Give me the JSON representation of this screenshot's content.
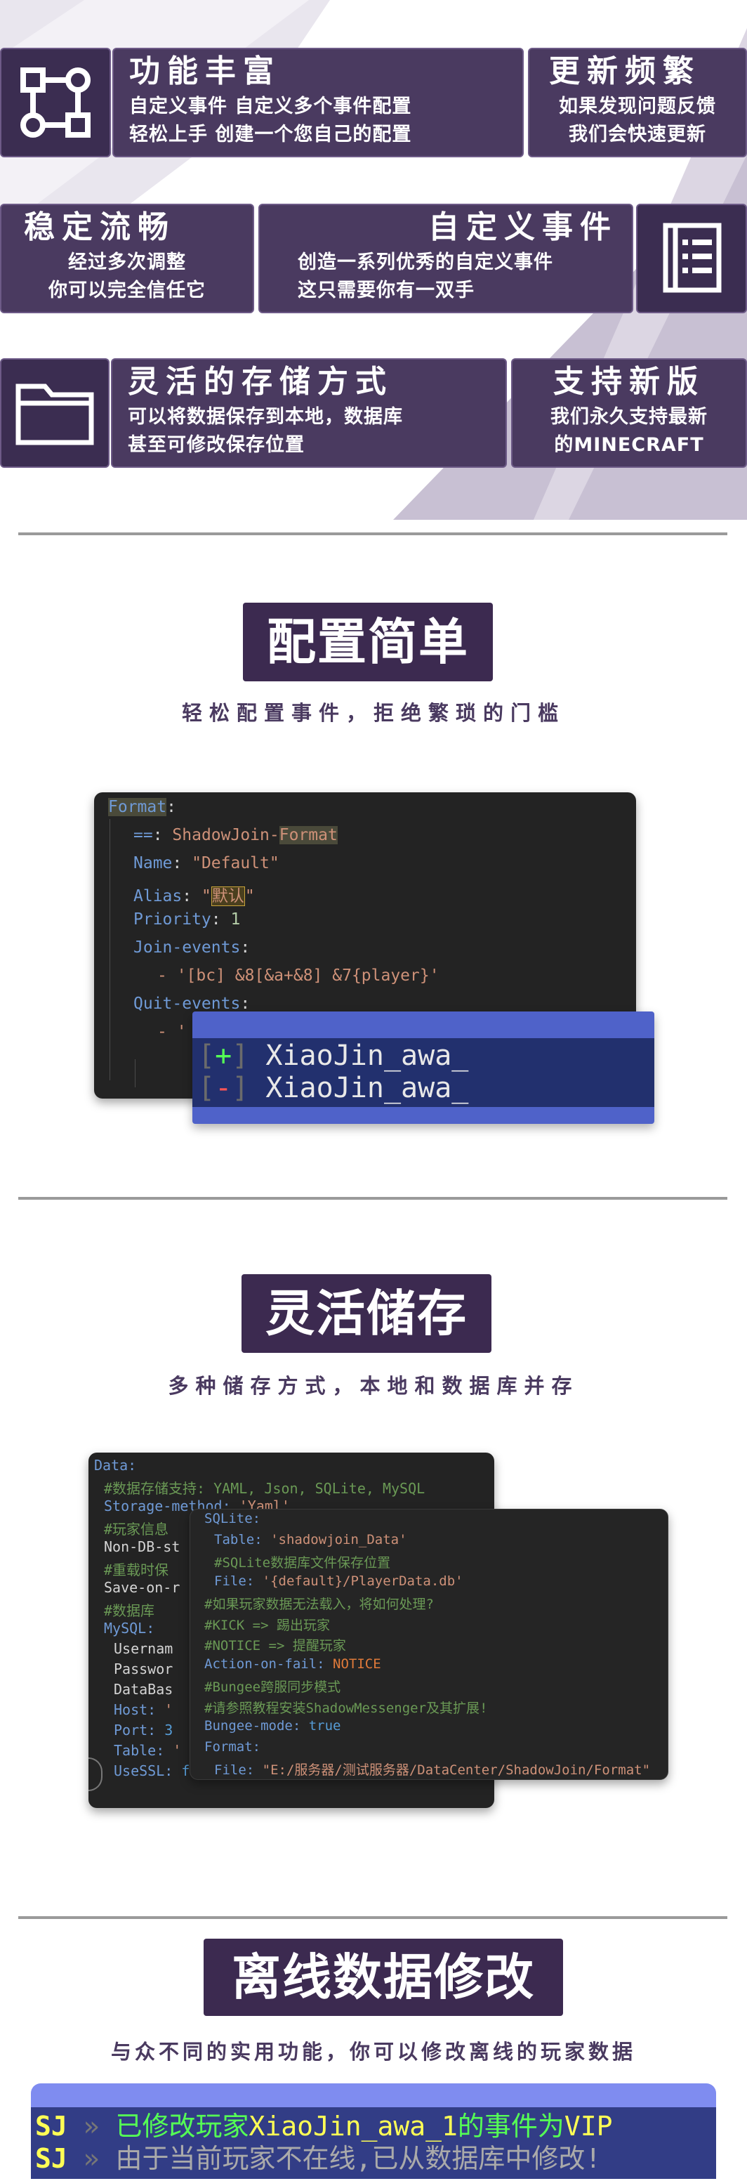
{
  "features": [
    {
      "title": "功能丰富",
      "lines": [
        "自定义事件 自定义多个事件配置",
        "轻松上手 创建一个您自己的配置"
      ],
      "icon": "node-graph-icon"
    },
    {
      "title": "更新频繁",
      "lines": [
        "如果发现问题反馈",
        "我们会快速更新"
      ]
    },
    {
      "title": "稳定流畅",
      "lines": [
        "经过多次调整",
        "你可以完全信任它"
      ]
    },
    {
      "title": "自定义事件",
      "lines": [
        "创造一系列优秀的自定义事件",
        "这只需要你有一双手"
      ],
      "icon": "document-list-icon"
    },
    {
      "title": "灵活的存储方式",
      "lines": [
        "可以将数据保存到本地，数据库",
        "甚至可修改保存位置"
      ],
      "icon": "folder-icon"
    },
    {
      "title": "支持新版",
      "lines": [
        "我们永久支持最新",
        "的MINECRAFT"
      ]
    }
  ],
  "section1": {
    "heading": "配置简单",
    "subheading": "轻松配置事件，拒绝繁琐的门槛",
    "code": {
      "l1_key": "Format",
      "l2_key": "==",
      "l2_val_a": "ShadowJoin-",
      "l2_val_b": "Format",
      "l3_key": "Name",
      "l3_val": "\"Default\"",
      "l4_key": "Alias",
      "l4_val": "默认",
      "l5_key": "Priority",
      "l5_val": "1",
      "l6_key": "Join-events",
      "l7_val": "- '[bc] &8[&a+&8] &7{player}'",
      "l8_key": "Quit-events",
      "l9_val": "- '"
    },
    "chat": {
      "join_symbol": "+",
      "quit_symbol": "-",
      "player": "XiaoJin_awa_"
    }
  },
  "section2": {
    "heading": "灵活储存",
    "subheading": "多种储存方式，本地和数据库并存",
    "back": [
      "Data:",
      "#数据存储支持: YAML, Json, SQLite, MySQL",
      "Storage-method: 'Yaml'",
      "#玩家信息",
      "Non-DB-st",
      "#重载时保",
      "Save-on-r",
      "#数据库",
      "MySQL:",
      "Usernam",
      "Passwor",
      "DataBas",
      "Host: '",
      "Port: 3",
      "Table: '",
      "UseSSL: false"
    ],
    "front": [
      "SQLite:",
      "Table: 'shadowjoin_Data'",
      "#SQLite数据库文件保存位置",
      "File: '{default}/PlayerData.db'",
      "#如果玩家数据无法载入，将如何处理?",
      "#KICK => 踢出玩家",
      "#NOTICE => 提醒玩家",
      "Action-on-fail: NOTICE",
      "#Bungee跨服同步模式",
      "#请参照教程安装ShadowMessenger及其扩展!",
      "Bungee-mode: true",
      "Format:",
      "File: \"E:/服务器/测试服务器/DataCenter/ShadowJoin/Format\""
    ]
  },
  "section3": {
    "heading": "离线数据修改",
    "subheading": "与众不同的实用功能，你可以修改离线的玩家数据",
    "chat": {
      "prefix": "SJ",
      "arrow": "»",
      "line1_a": "已修改玩家",
      "line1_player": "XiaoJin_awa_1",
      "line1_b": "的事件为",
      "line1_event": "VIP",
      "line2": "由于当前玩家不在线,已从数据库中修改!"
    }
  },
  "colors": {
    "accent": "#3c2a50",
    "card": "#4a3a60",
    "chat_blue": "#4f62c9",
    "chat_dark": "#22306e"
  }
}
